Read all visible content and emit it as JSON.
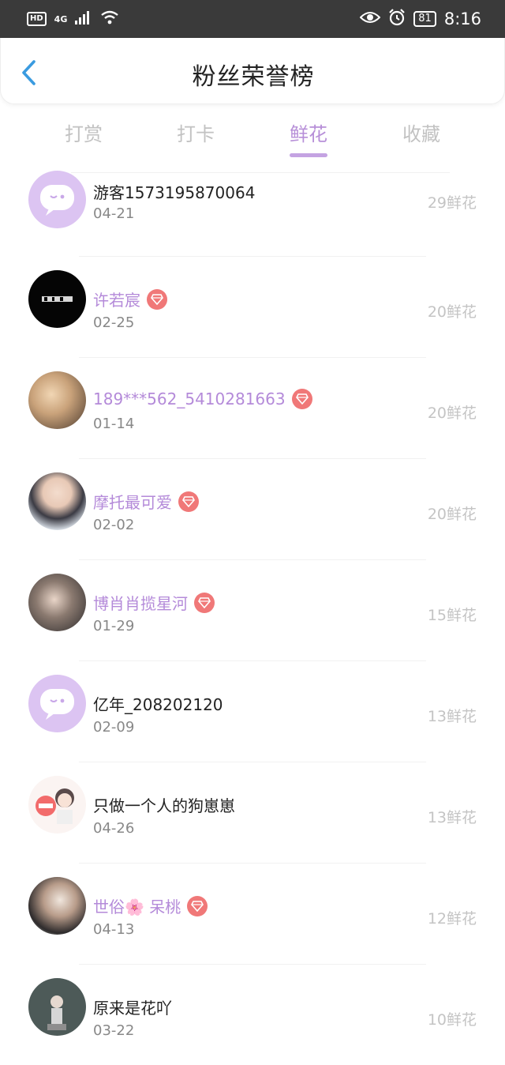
{
  "status_bar": {
    "hd": "HD",
    "network": "4G",
    "battery": "81",
    "time": "8:16"
  },
  "header": {
    "title": "粉丝荣誉榜"
  },
  "tabs": [
    {
      "label": "打赏"
    },
    {
      "label": "打卡"
    },
    {
      "label": "鲜花"
    },
    {
      "label": "收藏"
    }
  ],
  "active_tab": "鲜花",
  "entries": [
    {
      "name": "游客1573195870064",
      "date": "04-21",
      "amount": "29鲜花",
      "vip": false,
      "avatar": "default-chat-avatar"
    },
    {
      "name": "许若宸",
      "date": "02-25",
      "amount": "20鲜花",
      "vip": true,
      "avatar": "black-text-avatar"
    },
    {
      "name": "189***562_5410281663",
      "date": "01-14",
      "amount": "20鲜花",
      "vip": true,
      "avatar": "blonde-portrait-avatar"
    },
    {
      "name": "摩托最可爱",
      "date": "02-02",
      "amount": "20鲜花",
      "vip": true,
      "avatar": "portrait-avatar"
    },
    {
      "name": "博肖肖揽星河",
      "date": "01-29",
      "amount": "15鲜花",
      "vip": true,
      "avatar": "portrait-avatar"
    },
    {
      "name": "亿年_208202120",
      "date": "02-09",
      "amount": "13鲜花",
      "vip": false,
      "avatar": "default-chat-avatar"
    },
    {
      "name": "只做一个人的狗崽崽",
      "date": "04-26",
      "amount": "13鲜花",
      "vip": false,
      "avatar": "cartoon-avatar"
    },
    {
      "name": "世俗🌸 呆桃",
      "date": "04-13",
      "amount": "12鲜花",
      "vip": true,
      "avatar": "couple-avatar"
    },
    {
      "name": "原来是花吖",
      "date": "03-22",
      "amount": "10鲜花",
      "vip": false,
      "avatar": "photo-avatar"
    }
  ],
  "colors": {
    "accent": "#b78fd8",
    "vip_name": "#b48ad9",
    "gem_badge": "#f07878",
    "status_bar_bg": "#3a3a3a",
    "amount_text": "#c4c4c4"
  }
}
